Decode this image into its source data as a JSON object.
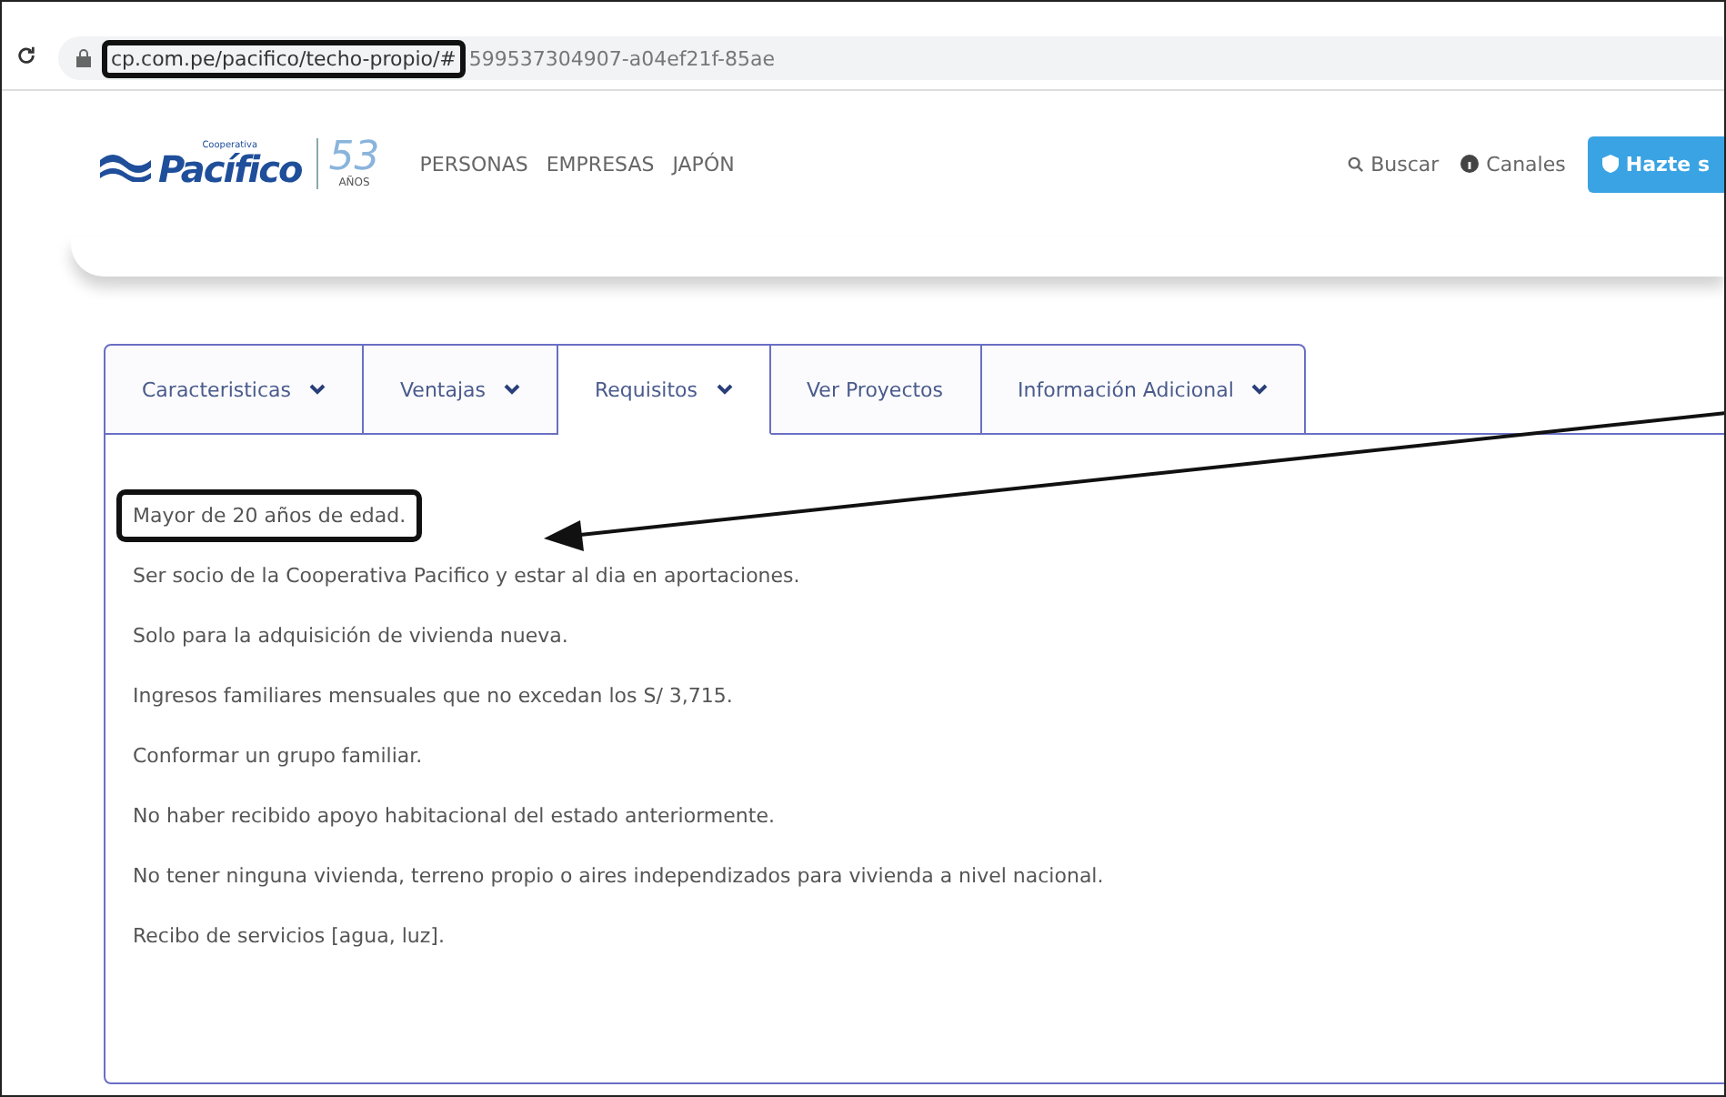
{
  "browser": {
    "url_highlighted": "cp.com.pe/pacifico/techo-propio/#",
    "url_rest": "599537304907-a04ef21f-85ae"
  },
  "header": {
    "logo": {
      "small": "Cooperativa",
      "name": "Pacífico",
      "years": "53",
      "years_label": "AÑOS"
    },
    "nav": [
      "PERSONAS",
      "EMPRESAS",
      "JAPÓN"
    ],
    "search": "Buscar",
    "channels": "Canales",
    "cta": "Hazte s"
  },
  "tabs": [
    {
      "label": "Caracteristicas",
      "dropdown": true,
      "selected": false
    },
    {
      "label": "Ventajas",
      "dropdown": true,
      "selected": false
    },
    {
      "label": "Requisitos",
      "dropdown": true,
      "selected": true
    },
    {
      "label": "Ver Proyectos",
      "dropdown": false,
      "selected": false
    },
    {
      "label": "Información Adicional",
      "dropdown": true,
      "selected": false
    }
  ],
  "requirements": [
    {
      "text": "Mayor de 20 años de edad.",
      "highlighted": true
    },
    {
      "text": "Ser socio de la Cooperativa Pacifico y estar al dia en aportaciones.",
      "highlighted": false
    },
    {
      "text": "Solo para la adquisición de vivienda nueva.",
      "highlighted": false
    },
    {
      "text": "Ingresos familiares mensuales que no excedan los S/ 3,715.",
      "highlighted": false
    },
    {
      "text": "Conformar un grupo familiar.",
      "highlighted": false
    },
    {
      "text": "No haber recibido apoyo habitacional del estado anteriormente.",
      "highlighted": false
    },
    {
      "text": "No tener ninguna vivienda, terreno propio o aires independizados para vivienda a nivel nacional.",
      "highlighted": false
    },
    {
      "text": "Recibo de servicios [agua, luz].",
      "highlighted": false
    }
  ],
  "annotations": {
    "url_highlighted": true,
    "arrow": true
  }
}
